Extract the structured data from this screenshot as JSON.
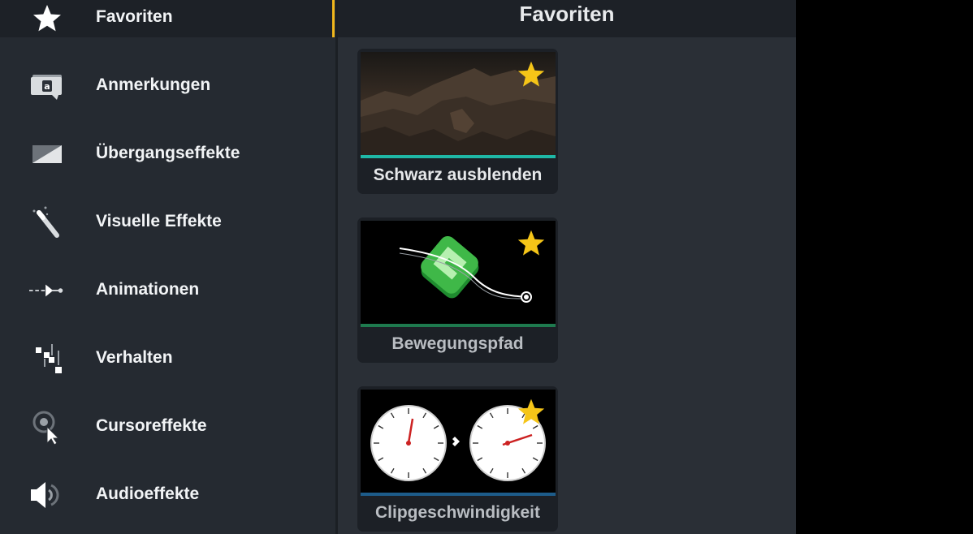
{
  "sidebar": {
    "items": [
      {
        "label": "Favoriten",
        "icon": "star-icon"
      },
      {
        "label": "Anmerkungen",
        "icon": "annotation-icon"
      },
      {
        "label": "Übergangseffekte",
        "icon": "transition-icon"
      },
      {
        "label": "Visuelle Effekte",
        "icon": "magic-wand-icon"
      },
      {
        "label": "Animationen",
        "icon": "animation-icon"
      },
      {
        "label": "Verhalten",
        "icon": "behavior-icon"
      },
      {
        "label": "Cursoreffekte",
        "icon": "cursor-effect-icon"
      },
      {
        "label": "Audioeffekte",
        "icon": "audio-icon"
      }
    ]
  },
  "header": {
    "title": "Favoriten"
  },
  "cards": [
    {
      "label": "Schwarz ausblenden",
      "bar_color": "#1fb8a6"
    },
    {
      "label": "Bewegungspfad",
      "bar_color": "#1e7a4e"
    },
    {
      "label": "Clipgeschwindigkeit",
      "bar_color": "#1d5c8a"
    }
  ],
  "colors": {
    "accent": "#f1b71c",
    "star": "#f5c518"
  }
}
